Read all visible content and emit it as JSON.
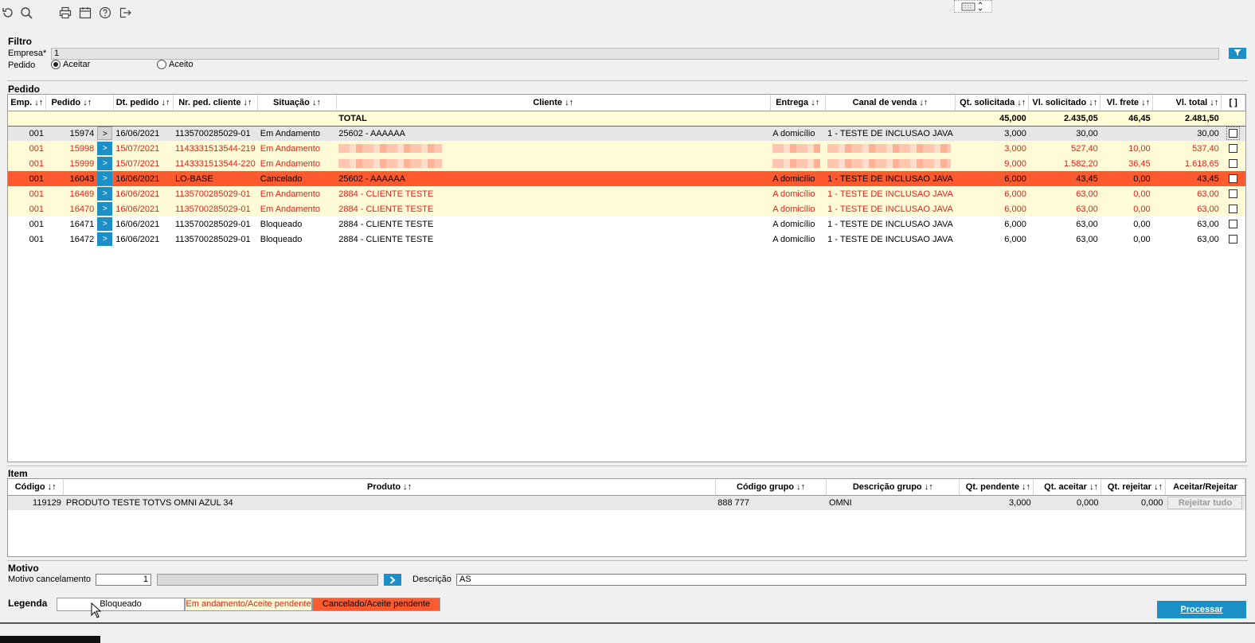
{
  "toolbar": {
    "icons": [
      "refresh-icon",
      "search-icon",
      "print-icon",
      "calendar-icon",
      "help-icon",
      "exit-icon"
    ]
  },
  "filtro": {
    "title": "Filtro",
    "empresa_label": "Empresa*",
    "empresa_value": "1",
    "pedido_label": "Pedido",
    "radio_aceitar": "Aceitar",
    "radio_aceito": "Aceito",
    "selected": "Aceitar"
  },
  "pedido": {
    "title": "Pedido",
    "columns": [
      "Emp. ↓↑",
      "Pedido ↓↑",
      "Dt. pedido ↓↑",
      "Nr. ped. cliente ↓↑",
      "Situação ↓↑",
      "Cliente ↓↑",
      "Entrega ↓↑",
      "Canal de venda ↓↑",
      "Qt. solicitada ↓↑",
      "Vl. solicitado ↓↑",
      "Vl. frete ↓↑",
      "Vl. total ↓↑",
      "[ ]"
    ],
    "total": {
      "label": "TOTAL",
      "qt": "45,000",
      "vl_solicitado": "2.435,05",
      "vl_frete": "46,45",
      "vl_total": "2.481,50"
    },
    "rows": [
      {
        "emp": "001",
        "pedido": "15974",
        "dt": "16/06/2021",
        "nr": "1135700285029-01",
        "situacao": "Em Andamento",
        "cliente": "25602 - AAAAAA",
        "entrega": "A domicílio",
        "canal": "1 - TESTE DE INCLUSAO JAVA",
        "qt": "3,000",
        "vl_sol": "30,00",
        "vl_frete": "",
        "vl_total": "30,00"
      },
      {
        "emp": "001",
        "pedido": "15998",
        "dt": "15/07/2021",
        "nr": "1143331513544-219",
        "situacao": "Em Andamento",
        "cliente": "",
        "entrega": "",
        "canal": "",
        "qt": "3,000",
        "vl_sol": "527,40",
        "vl_frete": "10,00",
        "vl_total": "537,40"
      },
      {
        "emp": "001",
        "pedido": "15999",
        "dt": "15/07/2021",
        "nr": "1143331513544-220",
        "situacao": "Em Andamento",
        "cliente": "",
        "entrega": "",
        "canal": "",
        "qt": "9,000",
        "vl_sol": "1.582,20",
        "vl_frete": "36,45",
        "vl_total": "1.618,65"
      },
      {
        "emp": "001",
        "pedido": "16043",
        "dt": "16/06/2021",
        "nr": "LO-BASE",
        "situacao": "Cancelado",
        "cliente": "25602 - AAAAAA",
        "entrega": "A domicílio",
        "canal": "1 - TESTE DE INCLUSAO JAVA",
        "qt": "6,000",
        "vl_sol": "43,45",
        "vl_frete": "0,00",
        "vl_total": "43,45"
      },
      {
        "emp": "001",
        "pedido": "16469",
        "dt": "16/06/2021",
        "nr": "1135700285029-01",
        "situacao": "Em Andamento",
        "cliente": "2884 - CLIENTE TESTE",
        "entrega": "A domicílio",
        "canal": "1 - TESTE DE INCLUSAO JAVA",
        "qt": "6,000",
        "vl_sol": "63,00",
        "vl_frete": "0,00",
        "vl_total": "63,00"
      },
      {
        "emp": "001",
        "pedido": "16470",
        "dt": "16/06/2021",
        "nr": "1135700285029-01",
        "situacao": "Em Andamento",
        "cliente": "2884 - CLIENTE TESTE",
        "entrega": "A domicílio",
        "canal": "1 - TESTE DE INCLUSAO JAVA",
        "qt": "6,000",
        "vl_sol": "63,00",
        "vl_frete": "0,00",
        "vl_total": "63,00"
      },
      {
        "emp": "001",
        "pedido": "16471",
        "dt": "16/06/2021",
        "nr": "1135700285029-01",
        "situacao": "Bloqueado",
        "cliente": "2884 - CLIENTE TESTE",
        "entrega": "A domicílio",
        "canal": "1 - TESTE DE INCLUSAO JAVA",
        "qt": "6,000",
        "vl_sol": "63,00",
        "vl_frete": "0,00",
        "vl_total": "63,00"
      },
      {
        "emp": "001",
        "pedido": "16472",
        "dt": "16/06/2021",
        "nr": "1135700285029-01",
        "situacao": "Bloqueado",
        "cliente": "2884 - CLIENTE TESTE",
        "entrega": "A domicílio",
        "canal": "1 - TESTE DE INCLUSAO JAVA",
        "qt": "6,000",
        "vl_sol": "63,00",
        "vl_frete": "0,00",
        "vl_total": "63,00"
      }
    ],
    "go_label": ">"
  },
  "item": {
    "title": "Item",
    "columns": [
      "Código ↓↑",
      "Produto ↓↑",
      "Código grupo ↓↑",
      "Descrição grupo ↓↑",
      "Qt. pendente ↓↑",
      "Qt. aceitar ↓↑",
      "Qt. rejeitar ↓↑",
      "Aceitar/Rejeitar"
    ],
    "rows": [
      {
        "codigo": "119129",
        "produto": "PRODUTO TESTE TOTVS OMNI AZUL 34",
        "codigo_grupo": "888 777",
        "descricao_grupo": "OMNI",
        "qt_pendente": "3,000",
        "qt_aceitar": "0,000",
        "qt_rejeitar": "0,000"
      }
    ],
    "reject_all_label": "Rejeitar tudo"
  },
  "motivo": {
    "title": "Motivo",
    "cancel_label": "Motivo cancelamento",
    "cancel_value": "1",
    "descricao_label": "Descrição",
    "descricao_value": "AS",
    "go_label": ">"
  },
  "legenda": {
    "title": "Legenda",
    "items": [
      "Bloqueado",
      "Em andamento/Aceite pendente",
      "Cancelado/Aceite pendente"
    ]
  },
  "actions": {
    "processar": "Processar"
  },
  "colors": {
    "accent": "#1b8fc6",
    "pending_bg": "#fffbd6",
    "pending_text": "#e1221b",
    "cancel_bg": "#fd5a30"
  }
}
